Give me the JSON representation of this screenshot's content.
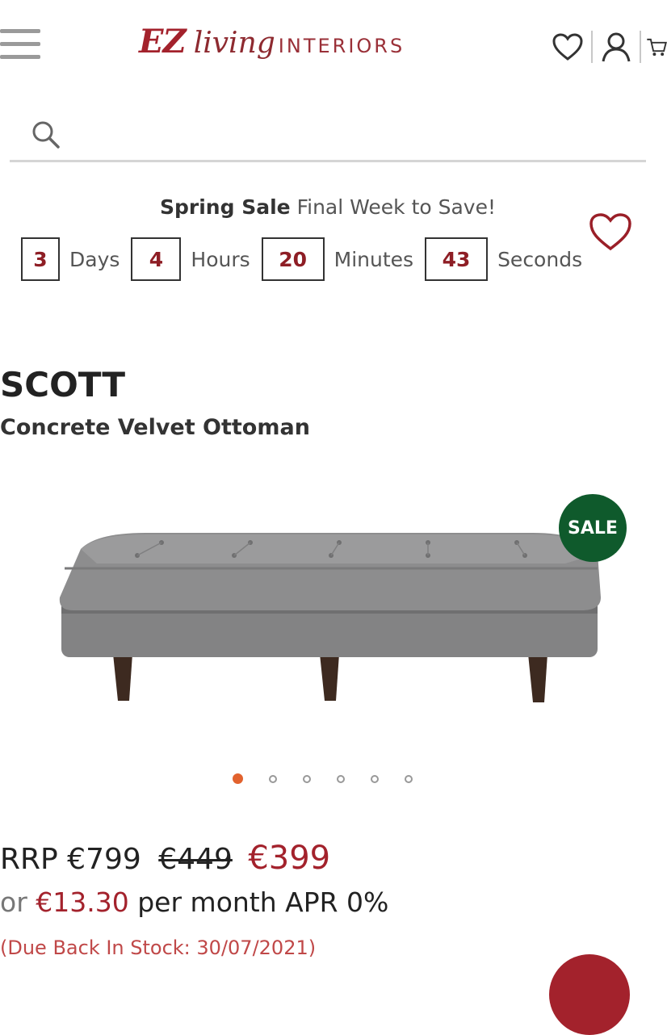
{
  "header": {
    "logo": {
      "ez": "EZ",
      "living": "living",
      "interiors": "INTERIORS"
    },
    "icons": [
      "menu-icon",
      "heart-icon",
      "user-icon",
      "cart-icon"
    ]
  },
  "search": {
    "placeholder": ""
  },
  "banner": {
    "title_bold": "Spring Sale",
    "title_rest": "Final Week to Save!",
    "countdown": {
      "days": "3",
      "days_label": "Days",
      "hours": "4",
      "hours_label": "Hours",
      "minutes": "20",
      "minutes_label": "Minutes",
      "seconds": "43",
      "seconds_label": "Seconds"
    }
  },
  "product": {
    "name": "SCOTT",
    "subtitle": "Concrete Velvet Ottoman",
    "badge": "SALE",
    "gallery": {
      "total_images": 6,
      "active_index": 0
    },
    "price": {
      "rrp_label": "RRP €799",
      "was": "€449",
      "now": "€399"
    },
    "finance": {
      "or": "or",
      "amount": "€13.30",
      "rest": "per month APR 0%"
    },
    "stock_note": "(Due Back In Stock: 30/07/2021)"
  },
  "colors": {
    "brand_red": "#a3222c",
    "sale_green": "#0f5a2c",
    "active_dot": "#e2622e"
  }
}
